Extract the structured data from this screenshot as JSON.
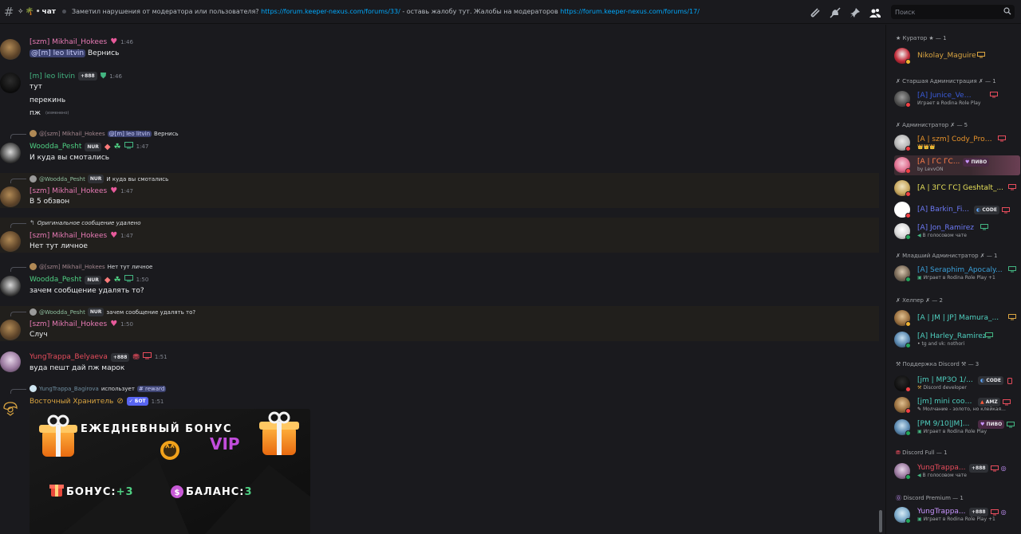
{
  "topbar": {
    "channel_name": "чат",
    "channel_prefix_icons": [
      "sparkle-icon",
      "palm-icon"
    ],
    "topic_text_1": "Заметил нарушения от модератора или пользователя? ",
    "topic_link_1": "https://forum.keeper-nexus.com/forums/33/",
    "topic_text_2": " - оставь жалобу тут. Жалобы на модераторов ",
    "topic_link_2": "https://forum.keeper-nexus.com/forums/17/",
    "search_placeholder": "Поиск"
  },
  "messages": [
    {
      "author": "[szm] Mikhail_Hokees",
      "time": "1:46",
      "mention": "@[m] leo litvin",
      "text": "Вернись"
    },
    {
      "author": "[m] leo litvin",
      "time": "1:46",
      "tag": "+888",
      "lines": [
        "тут",
        "перекинь",
        "пж"
      ],
      "edited": "(изменено)"
    },
    {
      "reply_author": "@[szm] Mikhail_Hokees",
      "reply_mention": "@[m] leo litvin",
      "reply_text": "Вернись",
      "author": "Woodda_Pesht",
      "tag": "NUR",
      "time": "1:47",
      "text": "И куда вы смотались"
    },
    {
      "reply_author": "@Woodda_Pesht",
      "reply_tag": "NUR",
      "reply_text": "И куда вы смотались",
      "author": "[szm] Mikhail_Hokees",
      "time": "1:47",
      "text": "В 5 обзвон"
    },
    {
      "reply_deleted": "Оригинальное сообщение удалено",
      "author": "[szm] Mikhail_Hokees",
      "time": "1:47",
      "text": "Нет тут личное"
    },
    {
      "reply_author": "@[szm] Mikhail_Hokees",
      "reply_text": "Нет тут личное",
      "author": "Woodda_Pesht",
      "tag": "NUR",
      "time": "1:50",
      "text": "зачем сообщение удалять то?"
    },
    {
      "reply_author": "@Woodda_Pesht",
      "reply_tag": "NUR",
      "reply_text": "зачем сообщение удалять то?",
      "author": "[szm] Mikhail_Hokees",
      "time": "1:50",
      "text": "Случ"
    },
    {
      "author": "YungTrappa_Belyaeva",
      "tag": "+888",
      "time": "1:51",
      "text": "вуда пешт дай пж марок"
    },
    {
      "reply_author": "YungTrappa_Bagirova",
      "reply_text": "использует",
      "reply_command": "# reward",
      "author": "Восточный Хранитель",
      "tag": "БОТ",
      "time": "1:51"
    }
  ],
  "banner": {
    "title": "ЕЖЕДНЕВНЫЙ БОНУС",
    "vip": "VIP",
    "bonus_label": "БОНУС:",
    "bonus_value": "+3",
    "balance_label": "БАЛАНС:",
    "balance_value": "3"
  },
  "members": {
    "roles": [
      {
        "header": "★ Куратор ★ — 1"
      },
      {
        "header": "✗ Старшая Администрация ✗ — 1"
      },
      {
        "header": "✗ Администратор ✗ — 5"
      },
      {
        "header": "✗ Младший Администратор ✗ — 1"
      },
      {
        "header": "✗ Хелпер ✗ — 2"
      },
      {
        "header": "⚒ Поддержка Discord ⚒ — 3"
      },
      {
        "header": "Discord Full — 1"
      },
      {
        "header": "Discord Premium — 1"
      }
    ],
    "list": [
      {
        "name": "Nikolay_Maguire"
      },
      {
        "name": "[A] Junice_Vectrall",
        "sub": "Играет в Rodina Role Play"
      },
      {
        "name": "[A | szm] Cody_Proven...",
        "sub": "👑👑👑"
      },
      {
        "name": "[A | ГС ГС...",
        "tag": "ПИВО",
        "sub": "by LevvON"
      },
      {
        "name": "[A | ЗГС ГС] Geshtalt_..."
      },
      {
        "name": "[A] Barkin_Fi...",
        "tag": "CODE"
      },
      {
        "name": "[A] Jon_Ramirez",
        "sub": "В голосовом чате"
      },
      {
        "name": "[A] Seraphim_Apocaly...",
        "sub": "Играет в Rodina Role Play +1"
      },
      {
        "name": "[A | JM | JP] Mamura_..."
      },
      {
        "name": "[A] Harley_Ramirez",
        "sub": "tg and vk: nothori"
      },
      {
        "name": "[jm | МРЗО 1/...",
        "tag": "CODE",
        "sub": "Discord developer"
      },
      {
        "name": "[jm] mini cooper",
        "tag": "AMZ",
        "sub": "Молчание - золото, но клейкая..."
      },
      {
        "name": "[PM 9/10|JM]...",
        "tag": "ПИВО",
        "sub": "Играет в Rodina Role Play"
      },
      {
        "name": "YungTrappa...",
        "tag": "+888",
        "sub": "В голосовом чате"
      },
      {
        "name": "YungTrappa...",
        "tag": "+888",
        "sub": "Играет в Rodina Role Play +1"
      }
    ]
  },
  "colors": {
    "background": "#1a1a1e",
    "link": "#00a8fc",
    "mention_bg": "#3c4270",
    "pink": "#e87bb5",
    "green": "#4fd083",
    "red": "#e74c5c",
    "gold": "#d9a441"
  }
}
